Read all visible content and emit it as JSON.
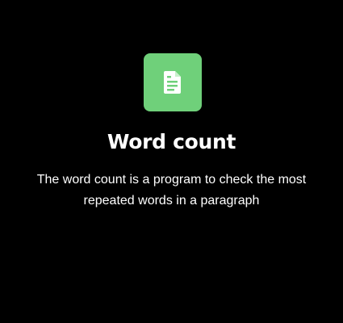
{
  "card": {
    "icon": "document-icon",
    "accent_color": "#6fd07a",
    "title": "Word count",
    "description": "The word count is a program to check the most repeated words in a paragraph"
  }
}
